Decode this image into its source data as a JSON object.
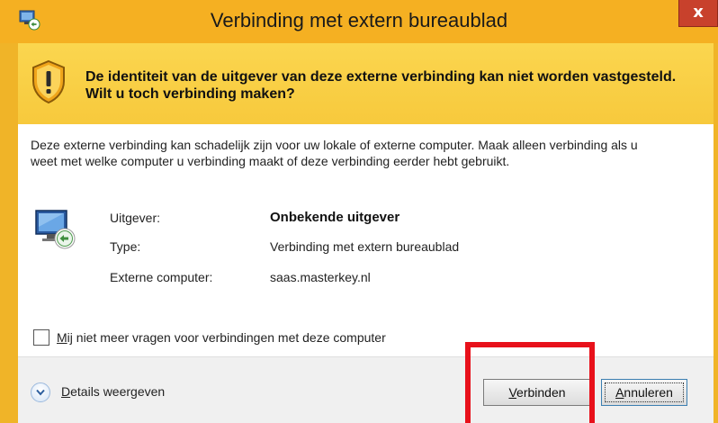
{
  "window": {
    "title": "Verbinding met extern bureaublad",
    "close_label": "x"
  },
  "warning": {
    "text": "De identiteit van de uitgever van deze externe verbinding kan niet worden vastgesteld. Wilt u toch verbinding maken?"
  },
  "description": "Deze externe verbinding kan schadelijk zijn voor uw lokale of externe computer. Maak alleen verbinding als u weet met welke computer u verbinding maakt of deze verbinding eerder hebt gebruikt.",
  "info": {
    "publisher_label": "Uitgever:",
    "publisher_value": "Onbekende uitgever",
    "type_label": "Type:",
    "type_value": "Verbinding met extern bureaublad",
    "remote_label": "Externe computer:",
    "remote_value": "saas.masterkey.nl"
  },
  "checkbox": {
    "label_first": "M",
    "label_rest": "ij niet meer vragen voor verbindingen met deze computer",
    "checked": false
  },
  "footer": {
    "details_first": "D",
    "details_rest": "etails weergeven",
    "connect_first": "V",
    "connect_rest": "erbinden",
    "cancel_first": "A",
    "cancel_rest": "nnuleren"
  },
  "colors": {
    "title_bar": "#f5b022",
    "warning_band": "#fbd24d",
    "close_button": "#c8412c",
    "highlight": "#e8111b"
  },
  "icons": [
    "remote-desktop-icon",
    "warning-shield-icon",
    "monitor-connection-icon",
    "chevron-down-icon"
  ]
}
